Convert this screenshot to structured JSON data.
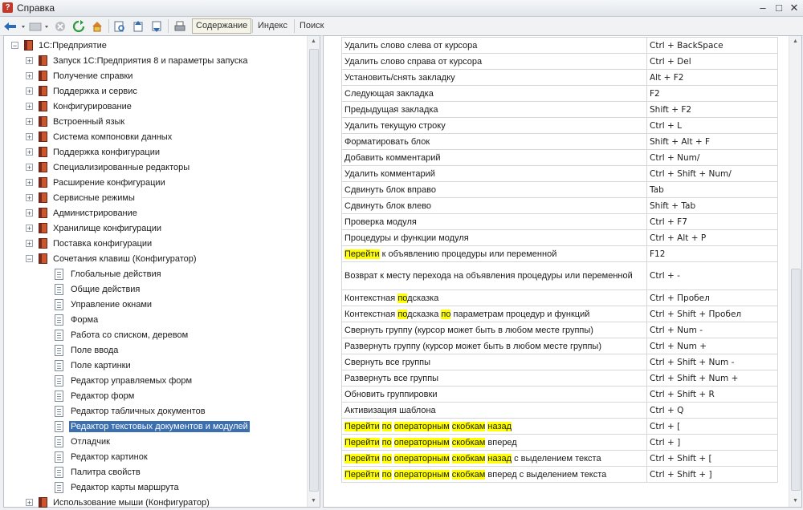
{
  "window": {
    "title": "Справка"
  },
  "toolbar": {
    "tabs": [
      "Содержание",
      "Индекс",
      "Поиск"
    ]
  },
  "tree": {
    "root": "1С:Предприятие",
    "topics": [
      "Запуск 1С:Предприятия 8 и параметры запуска",
      "Получение справки",
      "Поддержка и сервис",
      "Конфигурирование",
      "Встроенный язык",
      "Система компоновки данных",
      "Поддержка конфигурации",
      "Специализированные редакторы",
      "Расширение конфигурации",
      "Сервисные режимы",
      "Администрирование",
      "Хранилище конфигурации",
      "Поставка конфигурации"
    ],
    "expanded": "Сочетания клавиш (Конфигуратор)",
    "pages": [
      "Глобальные действия",
      "Общие действия",
      "Управление окнами",
      "Форма",
      "Работа со списком, деревом",
      "Поле ввода",
      "Поле картинки",
      "Редактор управляемых форм",
      "Редактор форм",
      "Редактор табличных документов",
      "Редактор текстовых документов и модулей",
      "Отладчик",
      "Редактор картинок",
      "Палитра свойств",
      "Редактор карты маршрута"
    ],
    "selected_page_index": 10,
    "last": "Использование мыши (Конфигуратор)"
  },
  "shortcuts": [
    {
      "parts": [
        {
          "t": "Удалить слово слева от курсора"
        }
      ],
      "keys": "Ctrl + BackSpace"
    },
    {
      "parts": [
        {
          "t": "Удалить слово справа от курсора"
        }
      ],
      "keys": "Ctrl + Del"
    },
    {
      "parts": [
        {
          "t": "Установить/снять закладку"
        }
      ],
      "keys": "Alt + F2"
    },
    {
      "parts": [
        {
          "t": "Следующая закладка"
        }
      ],
      "keys": "F2"
    },
    {
      "parts": [
        {
          "t": "Предыдущая закладка"
        }
      ],
      "keys": "Shift + F2"
    },
    {
      "parts": [
        {
          "t": "Удалить текущую строку"
        }
      ],
      "keys": "Ctrl + L"
    },
    {
      "parts": [
        {
          "t": "Форматировать блок"
        }
      ],
      "keys": "Shift + Alt + F"
    },
    {
      "parts": [
        {
          "t": "Добавить комментарий"
        }
      ],
      "keys": "Ctrl + Num/"
    },
    {
      "parts": [
        {
          "t": "Удалить комментарий"
        }
      ],
      "keys": "Ctrl + Shift + Num/"
    },
    {
      "parts": [
        {
          "t": "Сдвинуть блок вправо"
        }
      ],
      "keys": "Tab"
    },
    {
      "parts": [
        {
          "t": "Сдвинуть блок влево"
        }
      ],
      "keys": "Shift + Tab"
    },
    {
      "parts": [
        {
          "t": "Проверка модуля"
        }
      ],
      "keys": "Ctrl + F7"
    },
    {
      "parts": [
        {
          "t": "Процедуры и функции модуля"
        }
      ],
      "keys": "Ctrl + Alt + P"
    },
    {
      "parts": [
        {
          "t": "Перейти",
          "h": true
        },
        {
          "t": " к объявлению процедуры или переменной"
        }
      ],
      "keys": "F12"
    },
    {
      "parts": [
        {
          "t": "Возврат к месту перехода на объявления процедуры или переменной"
        }
      ],
      "keys": "Ctrl + -",
      "tall": true
    },
    {
      "parts": [
        {
          "t": "Контекстная "
        },
        {
          "t": "по",
          "h": true
        },
        {
          "t": "дсказка"
        }
      ],
      "keys": "Ctrl + Пробел"
    },
    {
      "parts": [
        {
          "t": "Контекстная "
        },
        {
          "t": "по",
          "h": true
        },
        {
          "t": "дсказка "
        },
        {
          "t": "по",
          "h": true
        },
        {
          "t": " параметрам процедур и функций"
        }
      ],
      "keys": "Ctrl + Shift + Пробел"
    },
    {
      "parts": [
        {
          "t": "Свернуть группу (курсор может быть в любом месте группы)"
        }
      ],
      "keys": "Ctrl + Num -"
    },
    {
      "parts": [
        {
          "t": "Развернуть группу (курсор может быть в любом месте группы)"
        }
      ],
      "keys": "Ctrl + Num +"
    },
    {
      "parts": [
        {
          "t": "Свернуть все группы"
        }
      ],
      "keys": "Ctrl + Shift + Num -"
    },
    {
      "parts": [
        {
          "t": "Развернуть все группы"
        }
      ],
      "keys": "Ctrl + Shift + Num +"
    },
    {
      "parts": [
        {
          "t": "Обновить группировки"
        }
      ],
      "keys": "Ctrl + Shift + R"
    },
    {
      "parts": [
        {
          "t": "Активизация шаблона"
        }
      ],
      "keys": "Ctrl + Q"
    },
    {
      "parts": [
        {
          "t": "Перейти",
          "h": true
        },
        {
          "t": " "
        },
        {
          "t": "по",
          "h": true
        },
        {
          "t": " "
        },
        {
          "t": "операторным",
          "h": true
        },
        {
          "t": " "
        },
        {
          "t": "скобкам",
          "h": true
        },
        {
          "t": " "
        },
        {
          "t": "назад",
          "h": true
        }
      ],
      "keys": "Ctrl + ["
    },
    {
      "parts": [
        {
          "t": "Перейти",
          "h": true
        },
        {
          "t": " "
        },
        {
          "t": "по",
          "h": true
        },
        {
          "t": " "
        },
        {
          "t": "операторным",
          "h": true
        },
        {
          "t": " "
        },
        {
          "t": "скобкам",
          "h": true
        },
        {
          "t": " вперед"
        }
      ],
      "keys": "Ctrl + ]"
    },
    {
      "parts": [
        {
          "t": "Перейти",
          "h": true
        },
        {
          "t": " "
        },
        {
          "t": "по",
          "h": true
        },
        {
          "t": " "
        },
        {
          "t": "операторным",
          "h": true
        },
        {
          "t": " "
        },
        {
          "t": "скобкам",
          "h": true
        },
        {
          "t": " "
        },
        {
          "t": "назад",
          "h": true
        },
        {
          "t": " с выделением текста"
        }
      ],
      "keys": "Ctrl + Shift + ["
    },
    {
      "parts": [
        {
          "t": "Перейти",
          "h": true
        },
        {
          "t": " "
        },
        {
          "t": "по",
          "h": true
        },
        {
          "t": " "
        },
        {
          "t": "операторным",
          "h": true
        },
        {
          "t": " "
        },
        {
          "t": "скобкам",
          "h": true
        },
        {
          "t": " вперед с выделением текста"
        }
      ],
      "keys": "Ctrl + Shift + ]"
    }
  ],
  "colors": {
    "selection": "#3c6fb0",
    "highlight": "#ffff00"
  }
}
